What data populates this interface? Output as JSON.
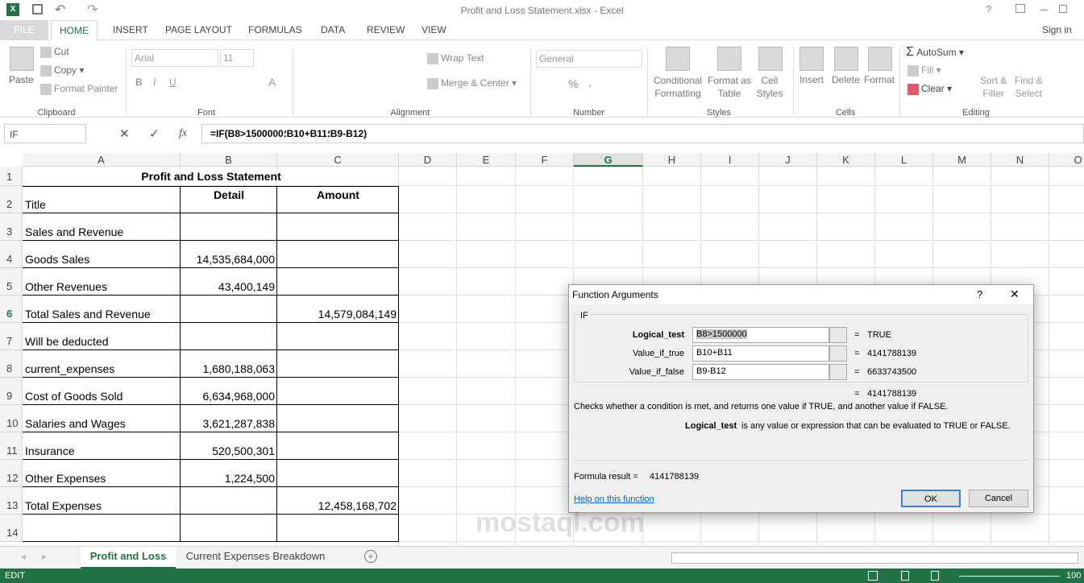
{
  "window": {
    "title": "Profit and Loss Statement.xlsx - Excel",
    "help": "?",
    "sign_in": "Sign in"
  },
  "tabs": [
    "FILE",
    "HOME",
    "INSERT",
    "PAGE LAYOUT",
    "FORMULAS",
    "DATA",
    "REVIEW",
    "VIEW"
  ],
  "ribbon": {
    "clipboard": {
      "paste": "Paste",
      "cut": "Cut",
      "copy": "Copy",
      "format_painter": "Format Painter",
      "label": "Clipboard"
    },
    "font": {
      "name": "Arial",
      "size": "11",
      "bold": "B",
      "italic": "I",
      "underline": "U",
      "font_color": "A",
      "label": "Font"
    },
    "alignment": {
      "wrap": "Wrap Text",
      "merge": "Merge & Center",
      "label": "Alignment"
    },
    "number": {
      "format": "General",
      "percent": "%",
      "comma": ",",
      "label": "Number"
    },
    "styles": {
      "conditional": "Conditional",
      "conditional2": "Formatting",
      "format_table": "Format as",
      "format_table2": "Table",
      "cell_styles": "Cell",
      "cell_styles2": "Styles",
      "label": "Styles"
    },
    "cells": {
      "insert": "Insert",
      "delete": "Delete",
      "format": "Format",
      "label": "Cells"
    },
    "editing": {
      "autosum": "AutoSum",
      "fill": "Fill",
      "clear": "Clear",
      "sort": "Sort &",
      "sort2": "Filter",
      "find": "Find &",
      "find2": "Select",
      "label": "Editing"
    }
  },
  "formula_bar": {
    "name_box": "IF",
    "fx": "fx",
    "formula": "=IF(B8>؛1500000B10+B؛11B9-B12)"
  },
  "columns": [
    "A",
    "B",
    "C",
    "D",
    "E",
    "F",
    "G",
    "H",
    "I",
    "J",
    "K",
    "L",
    "M",
    "N",
    "O"
  ],
  "selected_column": "G",
  "selected_row": "6",
  "rows": [
    {
      "n": "1",
      "a": "Profit and Loss Statement",
      "b": "",
      "c": ""
    },
    {
      "n": "2",
      "a": "Title",
      "b": "Detail",
      "c": "Amount"
    },
    {
      "n": "3",
      "a": "Sales and Revenue",
      "b": "",
      "c": ""
    },
    {
      "n": "4",
      "a": "Goods Sales",
      "b": "14,535,684,000",
      "c": ""
    },
    {
      "n": "5",
      "a": "Other Revenues",
      "b": "43,400,149",
      "c": ""
    },
    {
      "n": "6",
      "a": "Total Sales and Revenue",
      "b": "",
      "c": "14,579,084,149"
    },
    {
      "n": "7",
      "a": "Will be deducted",
      "b": "",
      "c": ""
    },
    {
      "n": "8",
      "a": "current_expenses",
      "b": "1,680,188,063",
      "c": ""
    },
    {
      "n": "9",
      "a": "Cost of Goods Sold",
      "b": "6,634,968,000",
      "c": ""
    },
    {
      "n": "10",
      "a": "Salaries and Wages",
      "b": "3,621,287,838",
      "c": ""
    },
    {
      "n": "11",
      "a": "Insurance",
      "b": "520,500,301",
      "c": ""
    },
    {
      "n": "12",
      "a": "Other Expenses",
      "b": "1,224,500",
      "c": ""
    },
    {
      "n": "13",
      "a": "Total Expenses",
      "b": "",
      "c": "12,458,168,702"
    },
    {
      "n": "14",
      "a": "",
      "b": "",
      "c": ""
    }
  ],
  "dialog": {
    "title": "Function Arguments",
    "help": "?",
    "close": "✕",
    "function": "IF",
    "args": [
      {
        "label": "Logical_test",
        "value": "B8>1500000",
        "result": "TRUE"
      },
      {
        "label": "Value_if_true",
        "value": "B10+B11",
        "result": "4141788139"
      },
      {
        "label": "Value_if_false",
        "value": "B9-B12",
        "result": "6633743500"
      }
    ],
    "eq": "=",
    "overall": "4141788139",
    "description": "Checks whether a condition is met, and returns one value if TRUE, and another value if FALSE.",
    "arg_name": "Logical_test",
    "arg_desc": "is any value or expression that can be evaluated to TRUE or FALSE.",
    "formula_result_label": "Formula result =",
    "formula_result": "4141788139",
    "help_link": "Help on this function",
    "ok": "OK",
    "cancel": "Cancel"
  },
  "sheet_tabs": [
    {
      "label": "Profit and Loss",
      "active": true
    },
    {
      "label": "Current Expenses Breakdown",
      "active": false
    }
  ],
  "status": {
    "mode": "EDIT",
    "zoom": "100"
  },
  "watermark": "mostaql.com",
  "colors": {
    "accent": "#217346",
    "status_bar": "#217346"
  }
}
